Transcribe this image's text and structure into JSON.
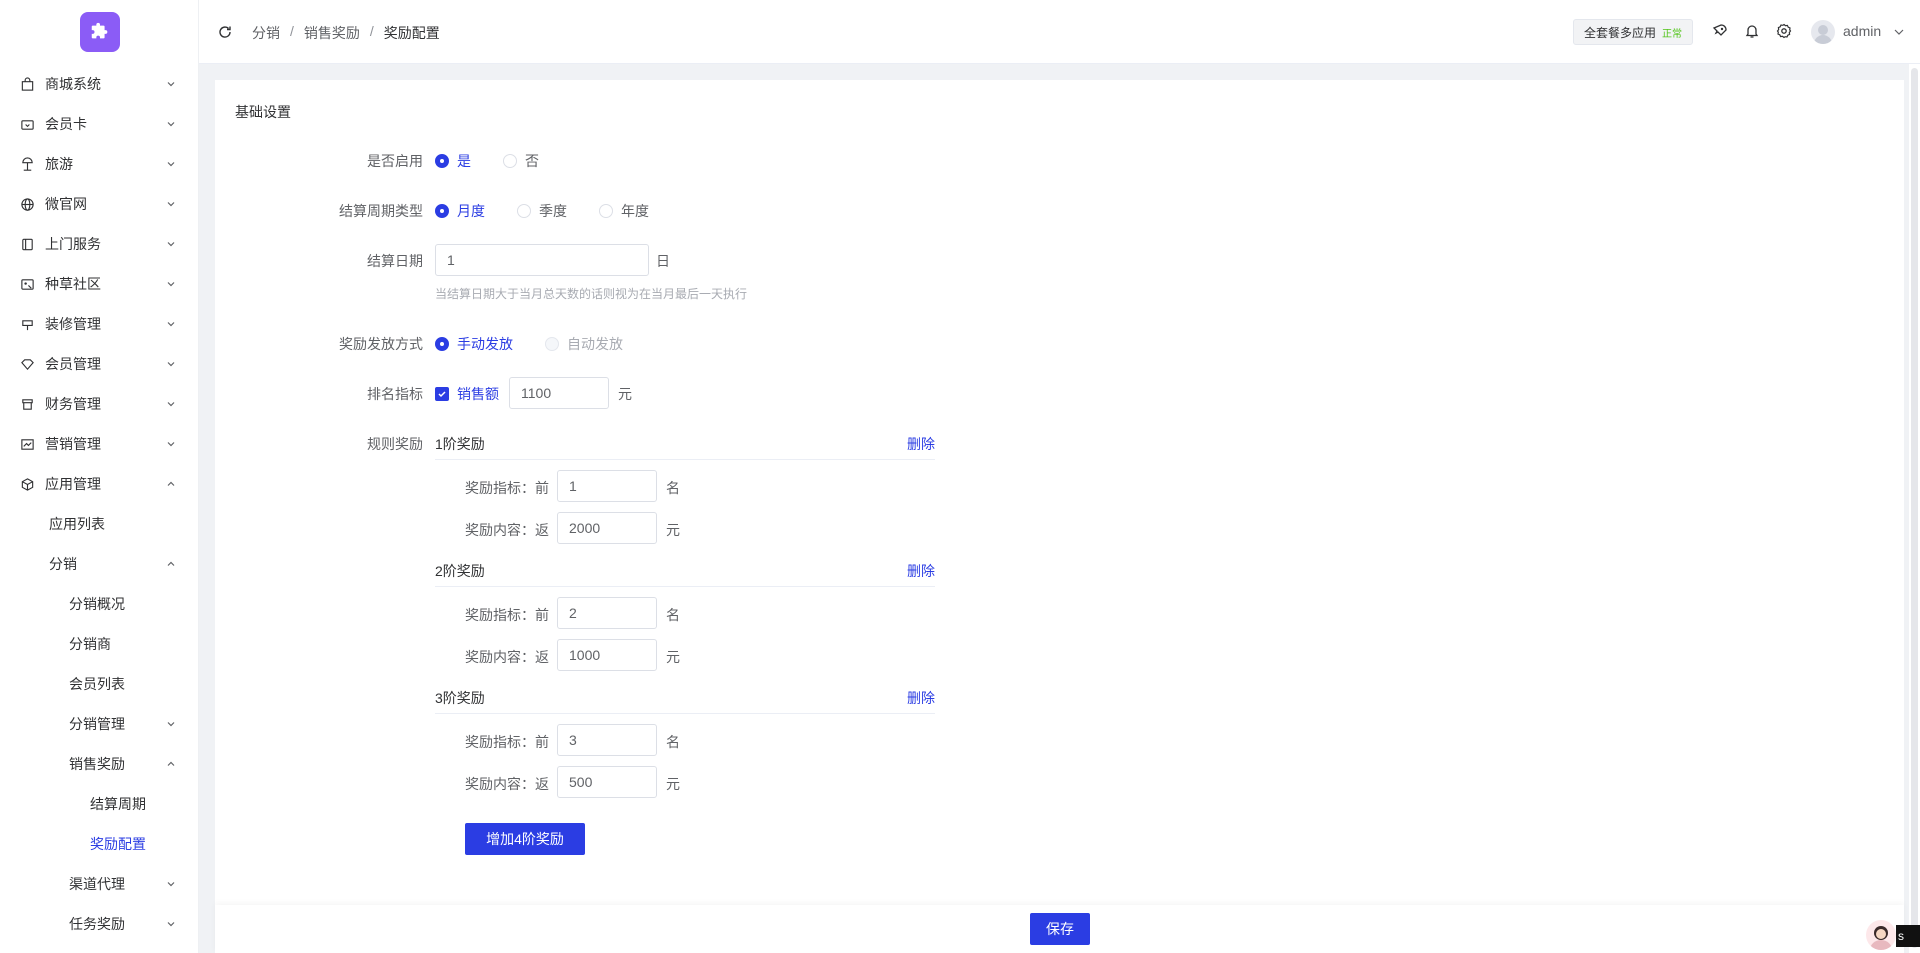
{
  "sidebar": {
    "items": [
      {
        "label": "商城系统",
        "icon": "shopping-bag-icon",
        "level": 1,
        "expanded": false
      },
      {
        "label": "会员卡",
        "icon": "card-icon",
        "level": 1,
        "expanded": false
      },
      {
        "label": "旅游",
        "icon": "beach-icon",
        "level": 1,
        "expanded": false
      },
      {
        "label": "微官网",
        "icon": "globe-icon",
        "level": 1,
        "expanded": false
      },
      {
        "label": "上门服务",
        "icon": "service-icon",
        "level": 1,
        "expanded": false
      },
      {
        "label": "种草社区",
        "icon": "community-icon",
        "level": 1,
        "expanded": false
      },
      {
        "label": "装修管理",
        "icon": "decoration-icon",
        "level": 1,
        "expanded": false
      },
      {
        "label": "会员管理",
        "icon": "diamond-icon",
        "level": 1,
        "expanded": false
      },
      {
        "label": "财务管理",
        "icon": "finance-icon",
        "level": 1,
        "expanded": false
      },
      {
        "label": "营销管理",
        "icon": "chart-icon",
        "level": 1,
        "expanded": false
      },
      {
        "label": "应用管理",
        "icon": "cube-icon",
        "level": 1,
        "expanded": true
      },
      {
        "label": "应用列表",
        "level": 2
      },
      {
        "label": "分销",
        "level": 2,
        "expanded": true
      },
      {
        "label": "分销概况",
        "level": 3
      },
      {
        "label": "分销商",
        "level": 3
      },
      {
        "label": "会员列表",
        "level": 3
      },
      {
        "label": "分销管理",
        "level": 3,
        "expanded": false
      },
      {
        "label": "销售奖励",
        "level": 3,
        "expanded": true
      },
      {
        "label": "结算周期",
        "level": 4
      },
      {
        "label": "奖励配置",
        "level": 4,
        "active": true
      },
      {
        "label": "渠道代理",
        "level": 3,
        "expanded": false
      },
      {
        "label": "任务奖励",
        "level": 3,
        "expanded": false
      }
    ]
  },
  "breadcrumb": [
    "分销",
    "销售奖励",
    "奖励配置"
  ],
  "header": {
    "plan_label": "全套餐多应用",
    "plan_status": "正常",
    "username": "admin"
  },
  "form": {
    "section_title": "基础设置",
    "enable": {
      "label": "是否启用",
      "options": [
        "是",
        "否"
      ],
      "selected": "是"
    },
    "cycle": {
      "label": "结算周期类型",
      "options": [
        "月度",
        "季度",
        "年度"
      ],
      "selected": "月度"
    },
    "settle_day": {
      "label": "结算日期",
      "value": "1",
      "unit": "日",
      "hint": "当结算日期大于当月总天数的话则视为在当月最后一天执行"
    },
    "payout": {
      "label": "奖励发放方式",
      "options": [
        "手动发放",
        "自动发放"
      ],
      "selected": "手动发放"
    },
    "ranking": {
      "label": "排名指标",
      "checkbox_label": "销售额",
      "checked": true,
      "value": "1100",
      "unit": "元"
    },
    "rules_label": "规则奖励",
    "tiers": [
      {
        "title": "1阶奖励",
        "delete": "删除",
        "metric_label": "奖励指标：前",
        "metric": "1",
        "metric_unit": "名",
        "content_label": "奖励内容：返",
        "content": "2000",
        "content_unit": "元"
      },
      {
        "title": "2阶奖励",
        "delete": "删除",
        "metric_label": "奖励指标：前",
        "metric": "2",
        "metric_unit": "名",
        "content_label": "奖励内容：返",
        "content": "1000",
        "content_unit": "元"
      },
      {
        "title": "3阶奖励",
        "delete": "删除",
        "metric_label": "奖励指标：前",
        "metric": "3",
        "metric_unit": "名",
        "content_label": "奖励内容：返",
        "content": "500",
        "content_unit": "元"
      }
    ],
    "add_button": "增加4阶奖励",
    "save_button": "保存"
  },
  "helper_tag": "s",
  "colors": {
    "primary": "#2b3de3",
    "logo": "#8b5cf6",
    "status_ok": "#52c41a"
  }
}
